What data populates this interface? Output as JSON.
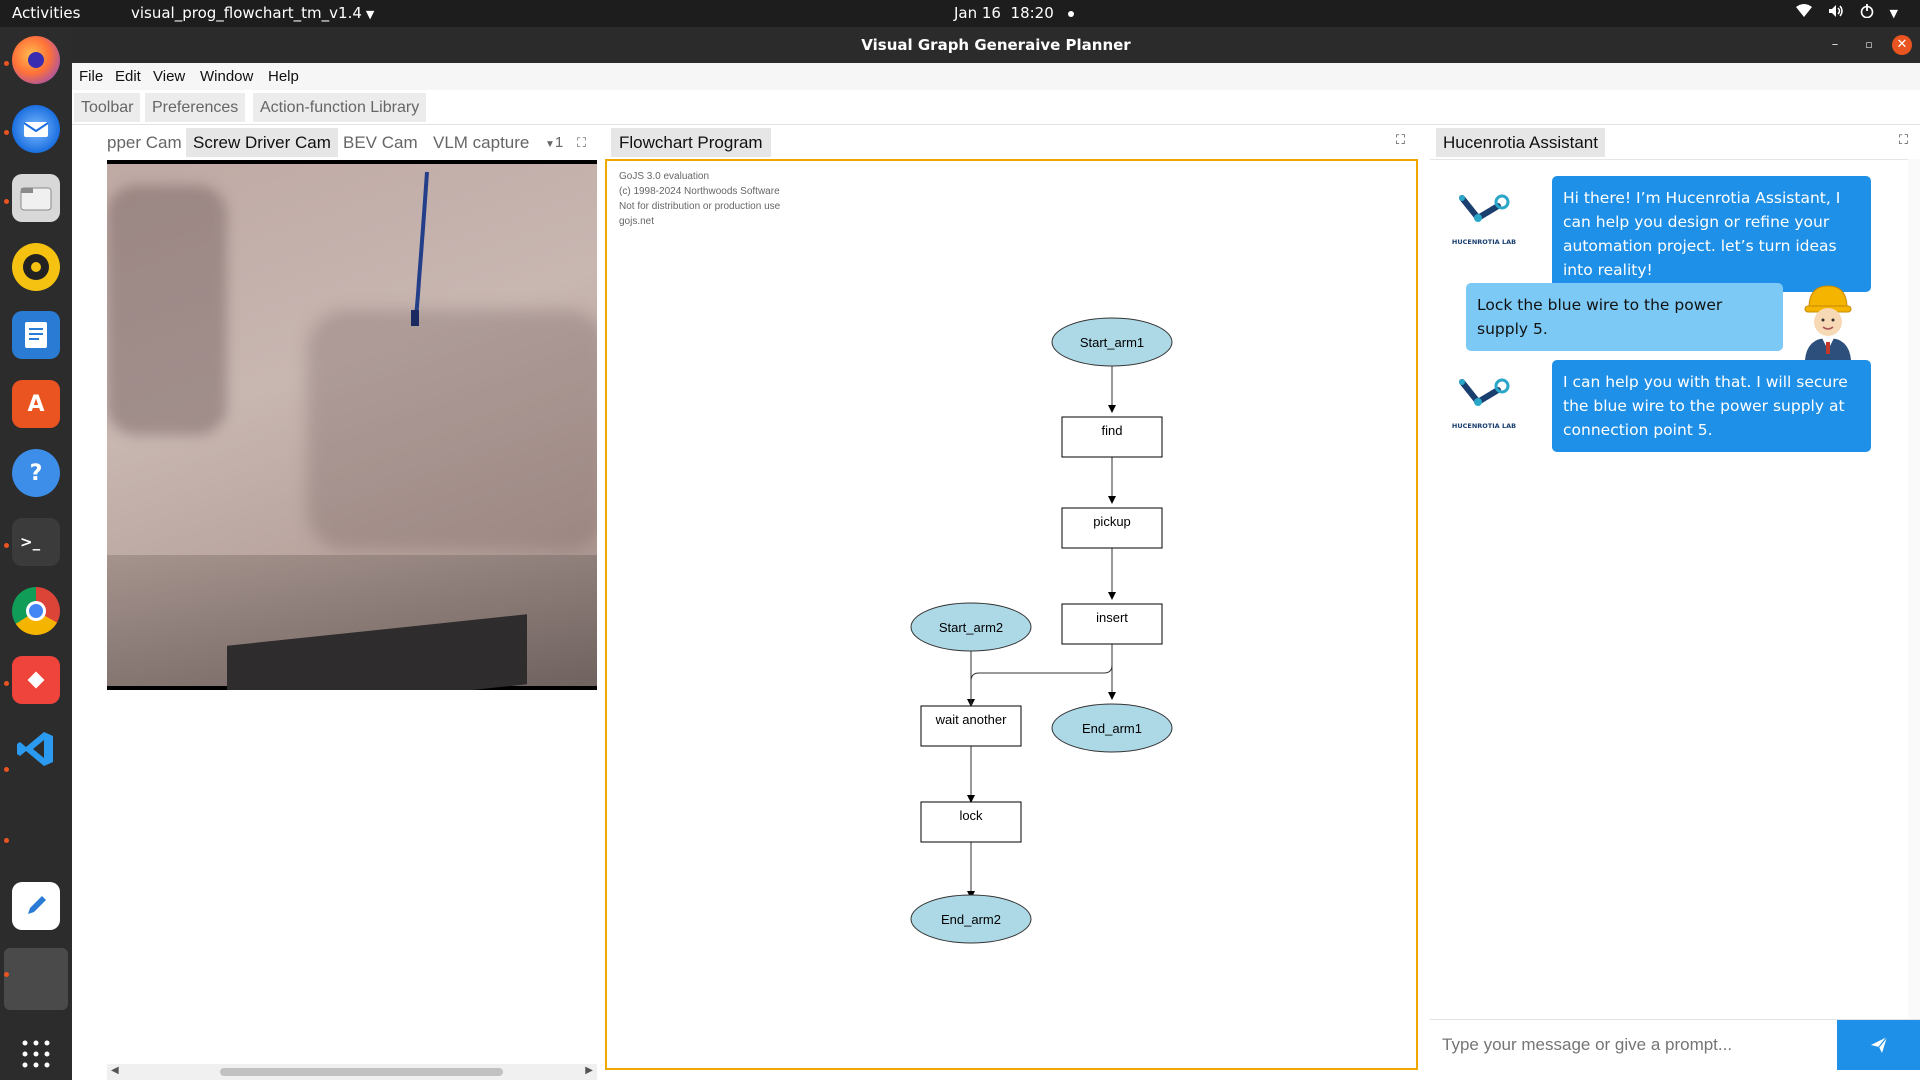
{
  "topbar": {
    "activities": "Activities",
    "app_menu": "visual_prog_flowchart_tm_v1.4",
    "date": "Jan 16",
    "time": "18:20"
  },
  "dock": {
    "items": [
      "firefox-icon",
      "thunderbird-icon",
      "files-icon",
      "rhythmbox-icon",
      "writer-icon",
      "app-center-icon",
      "help-icon",
      "terminal-icon",
      "chrome-icon",
      "anydesk-icon",
      "vscode-icon",
      "text-editor-icon",
      "active-app-icon",
      "show-apps-icon"
    ]
  },
  "window": {
    "title": "Visual Graph Generaive Planner",
    "menu": [
      "File",
      "Edit",
      "View",
      "Window",
      "Help"
    ],
    "toolbar": [
      "Toolbar",
      "Preferences",
      "Action-function Library"
    ]
  },
  "left_panel": {
    "tabs": [
      "pper Cam",
      "Screw Driver Cam",
      "BEV Cam",
      "VLM capture"
    ],
    "active_tab": "Screw Driver Cam",
    "tab_overflow": "1"
  },
  "center_panel": {
    "tab": "Flowchart Program",
    "license": [
      "GoJS 3.0 evaluation",
      "(c) 1998-2024 Northwoods Software",
      "Not for distribution or production use",
      "gojs.net"
    ],
    "nodes": {
      "start_arm1": "Start_arm1",
      "find": "find",
      "pickup": "pickup",
      "insert": "insert",
      "end_arm1": "End_arm1",
      "start_arm2": "Start_arm2",
      "wait_another": "wait another",
      "lock": "lock",
      "end_arm2": "End_arm2"
    }
  },
  "right_panel": {
    "tab": "Hucenrotia Assistant",
    "messages": [
      {
        "role": "assistant",
        "text": "Hi there! I’m Hucenrotia Assistant, I can help you design or refine your automation project. let’s turn ideas into reality!"
      },
      {
        "role": "user",
        "text": "Lock the blue wire to the power supply 5."
      },
      {
        "role": "assistant",
        "text": "I can help you with that. I will secure the blue wire to the power supply at connection point 5."
      }
    ],
    "logo_text": "HUCENROTIA LAB",
    "input_placeholder": "Type your message or give a prompt...",
    "send_icon": "send-icon"
  },
  "colors": {
    "accent": "#1e90e8",
    "user_bubble": "#7cc9f5",
    "canvas_border": "#f0a800",
    "terminal_node": "#add8e6",
    "close_button": "#e95420"
  }
}
